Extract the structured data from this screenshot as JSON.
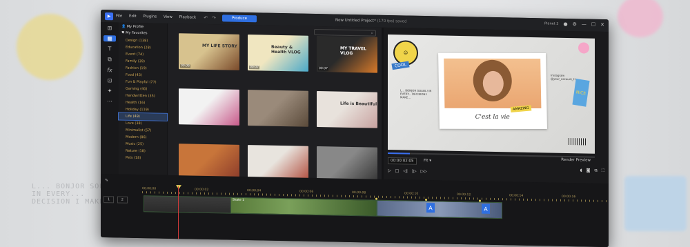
{
  "app": {
    "project_title": "New Untitled Project*",
    "project_meta": "(170 fps) saved",
    "menu": [
      "File",
      "Edit",
      "Plugins",
      "View",
      "Playback"
    ],
    "produce_label": "Produce",
    "account": "Planet 3"
  },
  "tools": [
    "media-room-icon",
    "template-icon",
    "title-icon",
    "transition-icon",
    "effect-icon",
    "pip-icon",
    "particle-icon",
    "more-icon"
  ],
  "categories": {
    "top": [
      "My Profile",
      "My Favorites"
    ],
    "items": [
      "Design (138)",
      "Education (28)",
      "Event (74)",
      "Family (39)",
      "Fashion (19)",
      "Food (43)",
      "Fun & Playful (77)",
      "Gaming (40)",
      "Handwritten (35)",
      "Health (16)",
      "Holiday (119)",
      "Life (49)",
      "Love (38)",
      "Minimalist (57)",
      "Modern (86)",
      "Music (25)",
      "Nature (18)",
      "Pets (18)"
    ],
    "selected_index": 11
  },
  "search": {
    "icon": "search-icon"
  },
  "templates": [
    {
      "caption": "MY LIFE STORY",
      "duration": "00:06",
      "colors": [
        "#d7c28e",
        "#7a4a2a"
      ]
    },
    {
      "caption": "Beauty & Health VLOG",
      "duration": "00:07",
      "colors": [
        "#f0e6c0",
        "#4aa8c8"
      ]
    },
    {
      "caption": "MY TRAVEL VLOG",
      "duration": "00:07",
      "colors": [
        "#2a2a2a",
        "#d87a2a"
      ]
    },
    {
      "caption": "",
      "duration": "",
      "colors": [
        "#f2f2f2",
        "#c85a8a"
      ]
    },
    {
      "caption": "",
      "duration": "",
      "colors": [
        "#9a8a7a",
        "#5a4a3a"
      ]
    },
    {
      "caption": "Life is Beautiful",
      "duration": "",
      "colors": [
        "#e8e2dc",
        "#c8a2a0"
      ]
    },
    {
      "caption": "",
      "duration": "",
      "colors": [
        "#c8753a",
        "#8a3a2a"
      ]
    },
    {
      "caption": "",
      "duration": "",
      "colors": [
        "#e8e4de",
        "#b04a3a"
      ]
    },
    {
      "caption": "",
      "duration": "",
      "colors": [
        "#888888",
        "#333333"
      ]
    }
  ],
  "preview": {
    "script_text": "C'est la vie",
    "cool_sticker": "COOL",
    "cool_label": "COOL",
    "nice_sticker": "NICE",
    "amazing_label": "AMAZING",
    "left_note": "L... BONJOR SOLEIL! IN EVERY... DECISION I MAKE...",
    "right_note": "Instagram @your_account_H",
    "timecode": "00:00:02:05",
    "fit_label": "Fit",
    "render_label": "Render Preview"
  },
  "timeline": {
    "ruler": [
      "00:00:00",
      "00:00:02",
      "00:00:04",
      "00:00:06",
      "00:00:08",
      "00:00:10",
      "00:00:12",
      "00:00:14",
      "00:00:16"
    ],
    "clip_label": "Skate 1",
    "track_buttons": [
      "1",
      "2"
    ]
  }
}
